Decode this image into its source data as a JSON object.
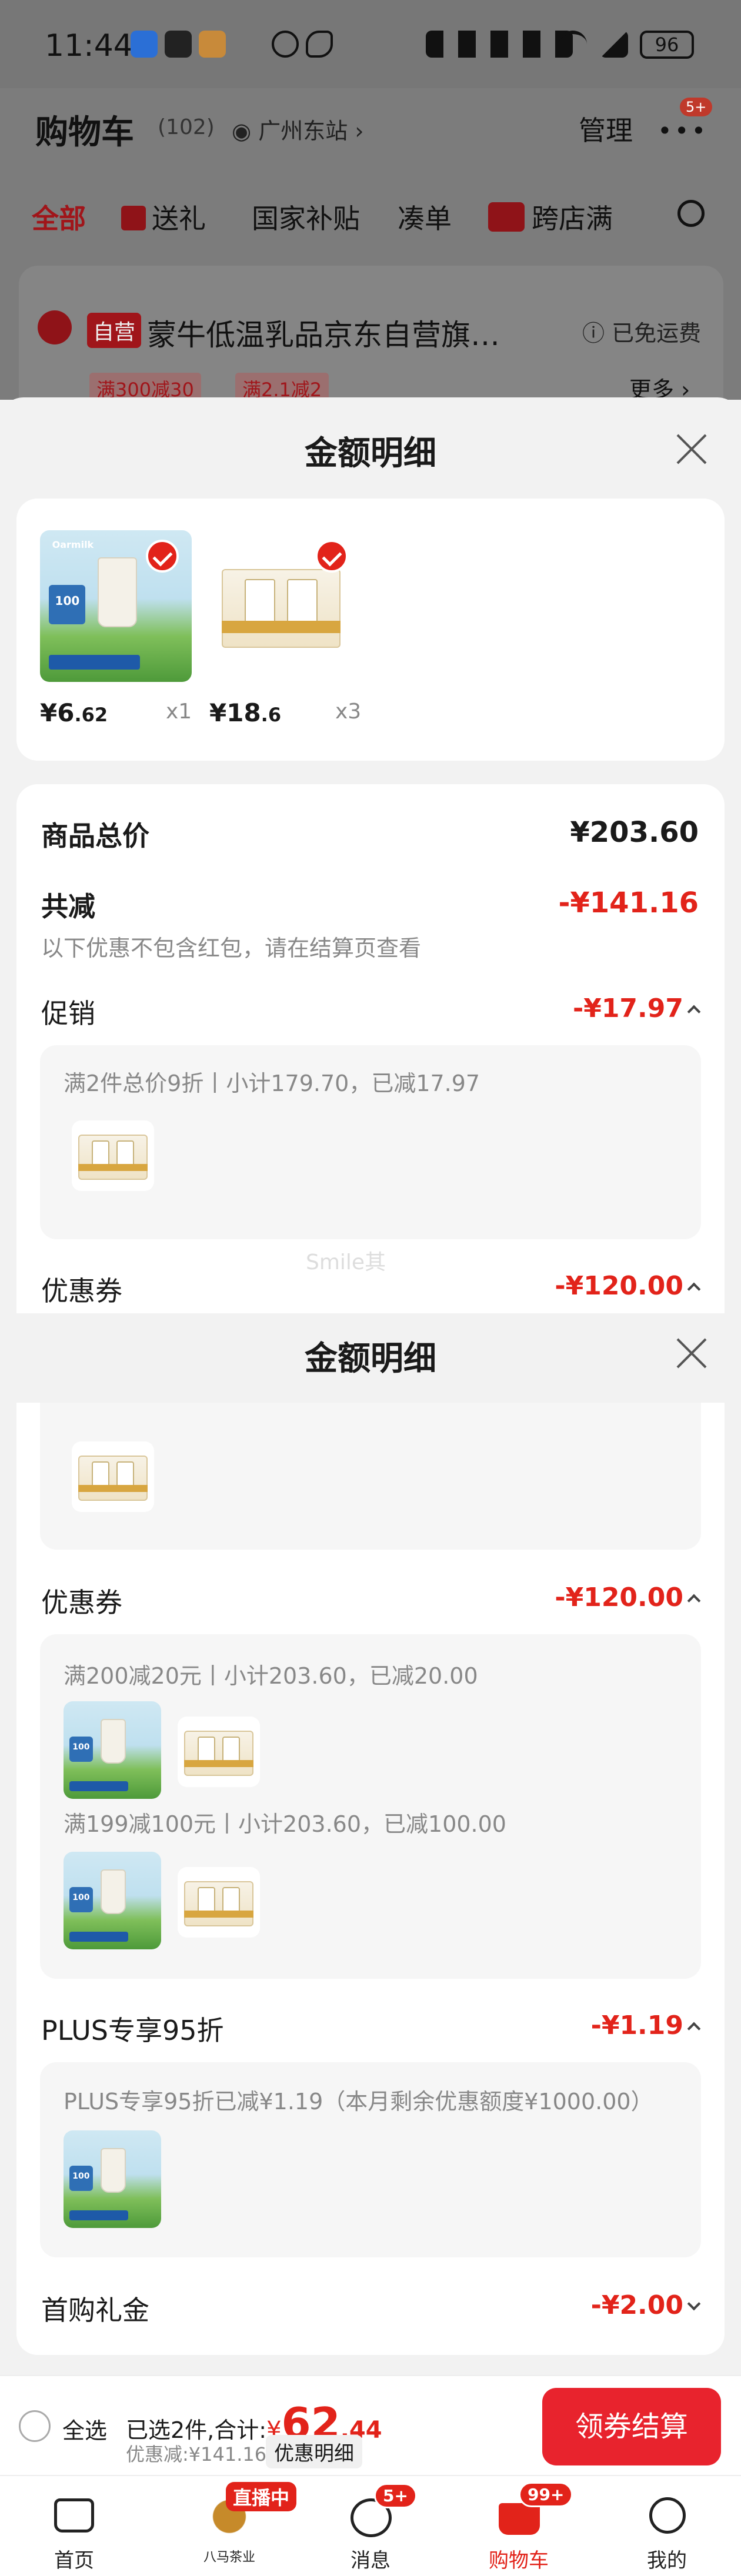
{
  "status_bar": {
    "time": "11:44",
    "battery": "96"
  },
  "background": {
    "title": "购物车",
    "count": "(102)",
    "location": "广州东站",
    "manage": "管理",
    "more_badge": "5+",
    "tabs": [
      "全部",
      "送礼",
      "国家补贴",
      "凑单",
      "跨店满"
    ],
    "shop_tag": "自营",
    "shop_name": "蒙牛低温乳品京东自营旗…",
    "free_shipping": "已免运费",
    "promos": [
      "满300减30",
      "满2.1减2"
    ],
    "more": "更多"
  },
  "sheet1": {
    "title": "金额明细",
    "items": [
      {
        "price_int": "¥6",
        "price_dec": ".62",
        "qty": "x1"
      },
      {
        "price_int": "¥18",
        "price_dec": ".6",
        "qty": "x3"
      }
    ],
    "total_label": "商品总价",
    "total_value": "¥203.60",
    "discount_label": "共减",
    "discount_value": "-¥141.16",
    "discount_note": "以下优惠不包含红包，请在结算页查看",
    "promo_label": "促销",
    "promo_value": "-¥17.97",
    "promo_detail": "满2件总价9折丨小计179.70，已减17.97",
    "coupon_label": "优惠券",
    "coupon_value": "-¥120.00",
    "watermark": "Smile其"
  },
  "sheet2": {
    "title": "金额明细",
    "coupon_label": "优惠券",
    "coupon_value": "-¥120.00",
    "coupon_detail_1": "满200减20元丨小计203.60，已减20.00",
    "coupon_detail_2": "满199减100元丨小计203.60，已减100.00",
    "plus_label": "PLUS专享95折",
    "plus_value": "-¥1.19",
    "plus_detail": "PLUS专享95折已减¥1.19（本月剩余优惠额度¥1000.00）",
    "first_label": "首购礼金",
    "first_value": "-¥2.00"
  },
  "checkout_bar": {
    "select_all": "全选",
    "selected": "已选2件,合计:",
    "total_prefix": "¥",
    "total_int": "62",
    "total_dec": ".44",
    "saved": "优惠减:¥141.16",
    "detail_button": "优惠明细",
    "checkout_button": "领券结算"
  },
  "tab_bar": {
    "home": "首页",
    "live_badge": "直播中",
    "live_brand": "八马茶业",
    "messages": "消息",
    "messages_badge": "5+",
    "cart": "购物车",
    "cart_badge": "99+",
    "mine": "我的"
  },
  "colors": {
    "accent": "#e2231a",
    "checkout": "#e8232d"
  }
}
